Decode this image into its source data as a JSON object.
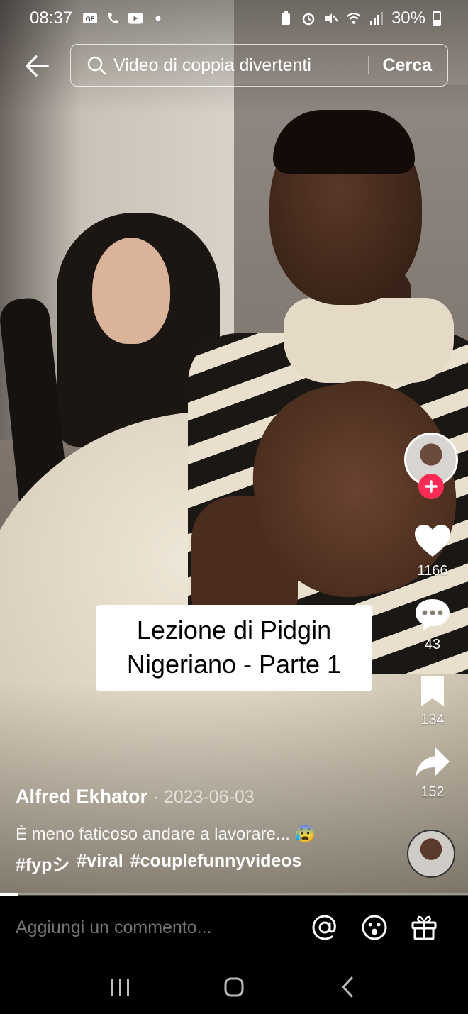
{
  "status_bar": {
    "time": "08:37",
    "battery": "30%"
  },
  "header": {
    "search_value": "Video di coppia divertenti",
    "search_button": "Cerca"
  },
  "video": {
    "sticker_line1": "Lezione di Pidgin",
    "sticker_line2": "Nigeriano - Parte 1",
    "author": "Alfred Ekhator",
    "date": "· 2023-06-03",
    "description": "È meno faticoso andare a lavorare... 😰",
    "hashtags": [
      "#fypシ",
      "#viral",
      "#couplefunnyvideos"
    ],
    "progress": 0.04
  },
  "actions": {
    "likes": "1166",
    "comments": "43",
    "saves": "134",
    "shares": "152"
  },
  "comment_bar": {
    "placeholder": "Aggiungi un commento..."
  },
  "colors": {
    "follow_accent": "#fe2c55",
    "background": "#000000"
  },
  "icons": {
    "back": "arrow-left-icon",
    "search": "search-icon",
    "like": "heart-icon",
    "comment": "comment-bubble-icon",
    "save": "bookmark-icon",
    "share": "share-arrow-icon",
    "mention": "at-icon",
    "emoji": "emoji-icon",
    "gift": "gift-icon"
  }
}
